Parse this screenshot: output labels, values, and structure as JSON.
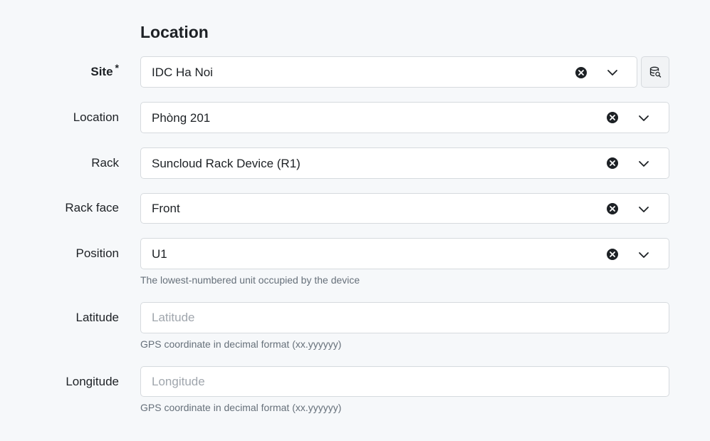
{
  "section": {
    "title": "Location"
  },
  "fields": {
    "site": {
      "label": "Site",
      "required_mark": "*",
      "value": "IDC Ha Noi"
    },
    "location": {
      "label": "Location",
      "value": "Phòng 201"
    },
    "rack": {
      "label": "Rack",
      "value": "Suncloud Rack Device (R1)"
    },
    "rack_face": {
      "label": "Rack face",
      "value": "Front"
    },
    "position": {
      "label": "Position",
      "value": "U1",
      "help": "The lowest-numbered unit occupied by the device"
    },
    "latitude": {
      "label": "Latitude",
      "value": "",
      "placeholder": "Latitude",
      "help": "GPS coordinate in decimal format (xx.yyyyyy)"
    },
    "longitude": {
      "label": "Longitude",
      "value": "",
      "placeholder": "Longitude",
      "help": "GPS coordinate in decimal format (xx.yyyyyy)"
    }
  },
  "icons": {
    "clear": "clear-icon",
    "chevron": "chevron-down-icon",
    "selector": "database-search-icon"
  },
  "colors": {
    "background": "#f6f8fa",
    "field_border": "#d6dade",
    "text": "#1d2125",
    "help_text": "#66707a",
    "placeholder": "#a0a6ad"
  }
}
